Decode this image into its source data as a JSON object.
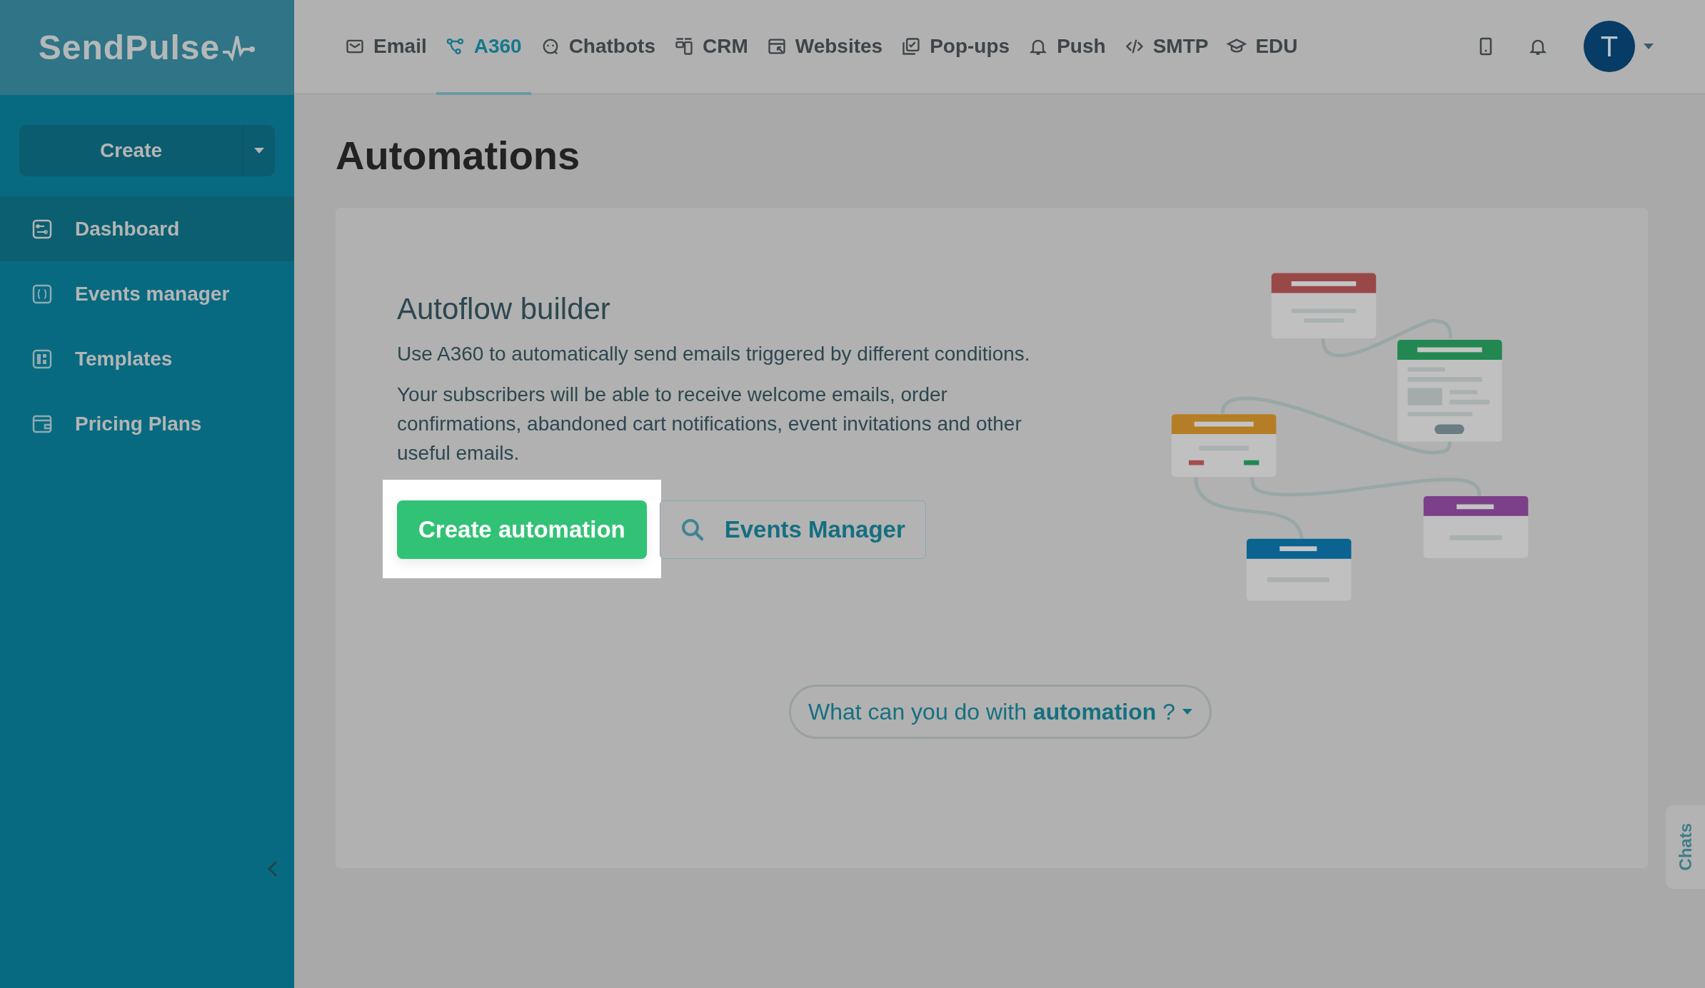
{
  "logo": {
    "text": "SendPulse"
  },
  "nav": [
    {
      "label": "Email",
      "selected": false
    },
    {
      "label": "A360",
      "selected": true
    },
    {
      "label": "Chatbots",
      "selected": false
    },
    {
      "label": "CRM",
      "selected": false
    },
    {
      "label": "Websites",
      "selected": false
    },
    {
      "label": "Pop-ups",
      "selected": false
    },
    {
      "label": "Push",
      "selected": false
    },
    {
      "label": "SMTP",
      "selected": false
    },
    {
      "label": "EDU",
      "selected": false
    }
  ],
  "user": {
    "initial": "T"
  },
  "sidebar": {
    "create_button": "Create",
    "items": [
      {
        "label": "Dashboard",
        "selected": true
      },
      {
        "label": "Events manager",
        "selected": false
      },
      {
        "label": "Templates",
        "selected": false
      },
      {
        "label": "Pricing Plans",
        "selected": false
      }
    ]
  },
  "page": {
    "title": "Automations"
  },
  "card": {
    "heading": "Autoflow builder",
    "paragraphs": [
      "Use A360 to automatically send emails triggered by different conditions.",
      "Your subscribers will be able to receive welcome emails, order confirmations, abandoned cart notifications, event invitations and other useful emails."
    ],
    "primary_button": "Create automation",
    "secondary_button": "Events Manager",
    "help_link": "What can you do with **automation** ?"
  },
  "chats_tab": "Chats"
}
